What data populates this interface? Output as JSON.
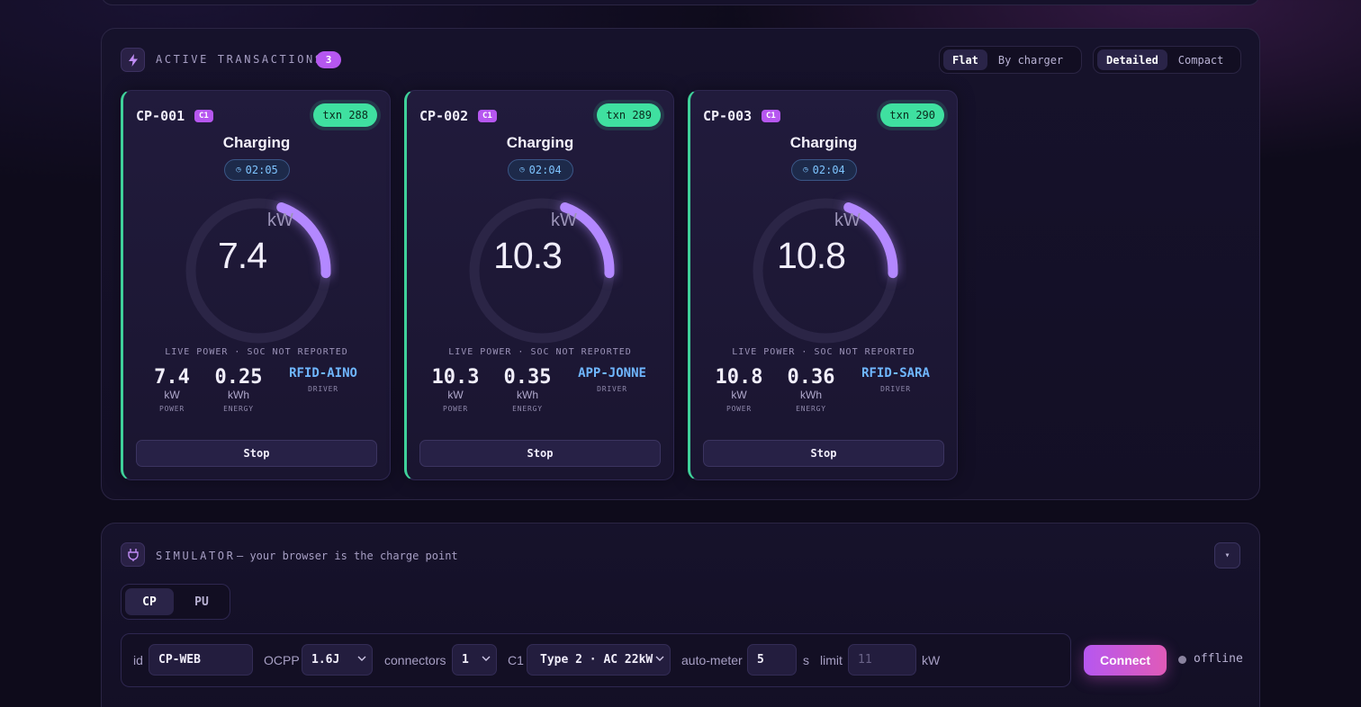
{
  "transactions": {
    "title": "ACTIVE TRANSACTIONS",
    "count": "3",
    "view_flat": "Flat",
    "view_by_charger": "By charger",
    "density_detailed": "Detailed",
    "density_compact": "Compact",
    "cards": [
      {
        "id": "CP-001",
        "connector": "C1",
        "txn": "txn 288",
        "status": "Charging",
        "timer": "02:05",
        "gauge_value": "7.4",
        "gauge_unit": "kW",
        "gauge_level": 0.2,
        "live_label": "LIVE POWER · SOC NOT REPORTED",
        "power": "7.4",
        "power_unit": "kW",
        "power_label": "POWER",
        "energy": "0.25",
        "energy_unit": "kWh",
        "energy_label": "ENERGY",
        "driver": "RFID-AINO",
        "driver_label": "DRIVER",
        "stop_label": "Stop"
      },
      {
        "id": "CP-002",
        "connector": "C1",
        "txn": "txn 289",
        "status": "Charging",
        "timer": "02:04",
        "gauge_value": "10.3",
        "gauge_unit": "kW",
        "gauge_level": 0.2,
        "live_label": "LIVE POWER · SOC NOT REPORTED",
        "power": "10.3",
        "power_unit": "kW",
        "power_label": "POWER",
        "energy": "0.35",
        "energy_unit": "kWh",
        "energy_label": "ENERGY",
        "driver": "APP-JONNE",
        "driver_label": "DRIVER",
        "stop_label": "Stop"
      },
      {
        "id": "CP-003",
        "connector": "C1",
        "txn": "txn 290",
        "status": "Charging",
        "timer": "02:04",
        "gauge_value": "10.8",
        "gauge_unit": "kW",
        "gauge_level": 0.2,
        "live_label": "LIVE POWER · SOC NOT REPORTED",
        "power": "10.8",
        "power_unit": "kW",
        "power_label": "POWER",
        "energy": "0.36",
        "energy_unit": "kWh",
        "energy_label": "ENERGY",
        "driver": "RFID-SARA",
        "driver_label": "DRIVER",
        "stop_label": "Stop"
      }
    ]
  },
  "simulator": {
    "title": "SIMULATOR",
    "subtitle": "— your browser is the charge point",
    "toggle_icon": "▾",
    "mode_cp": "CP",
    "mode_pu": "PU",
    "id_label": "id",
    "id_value": "CP-WEB",
    "ocpp_label": "OCPP",
    "ocpp_value": "1.6J",
    "connectors_label": "connectors",
    "connectors_value": "1",
    "c1_label": "C1",
    "c1_value": "Type 2 · AC 22kW",
    "auto_meter_label": "auto-meter",
    "auto_meter_value": "5",
    "auto_meter_unit": "s",
    "limit_label": "limit",
    "limit_placeholder": "11",
    "limit_unit": "kW",
    "connect_label": "Connect",
    "status": "offline"
  },
  "colors": {
    "accent": "#b657f0",
    "charging": "#3fe0a0",
    "gauge": "#b388ff",
    "driver": "#6fb6ff"
  }
}
